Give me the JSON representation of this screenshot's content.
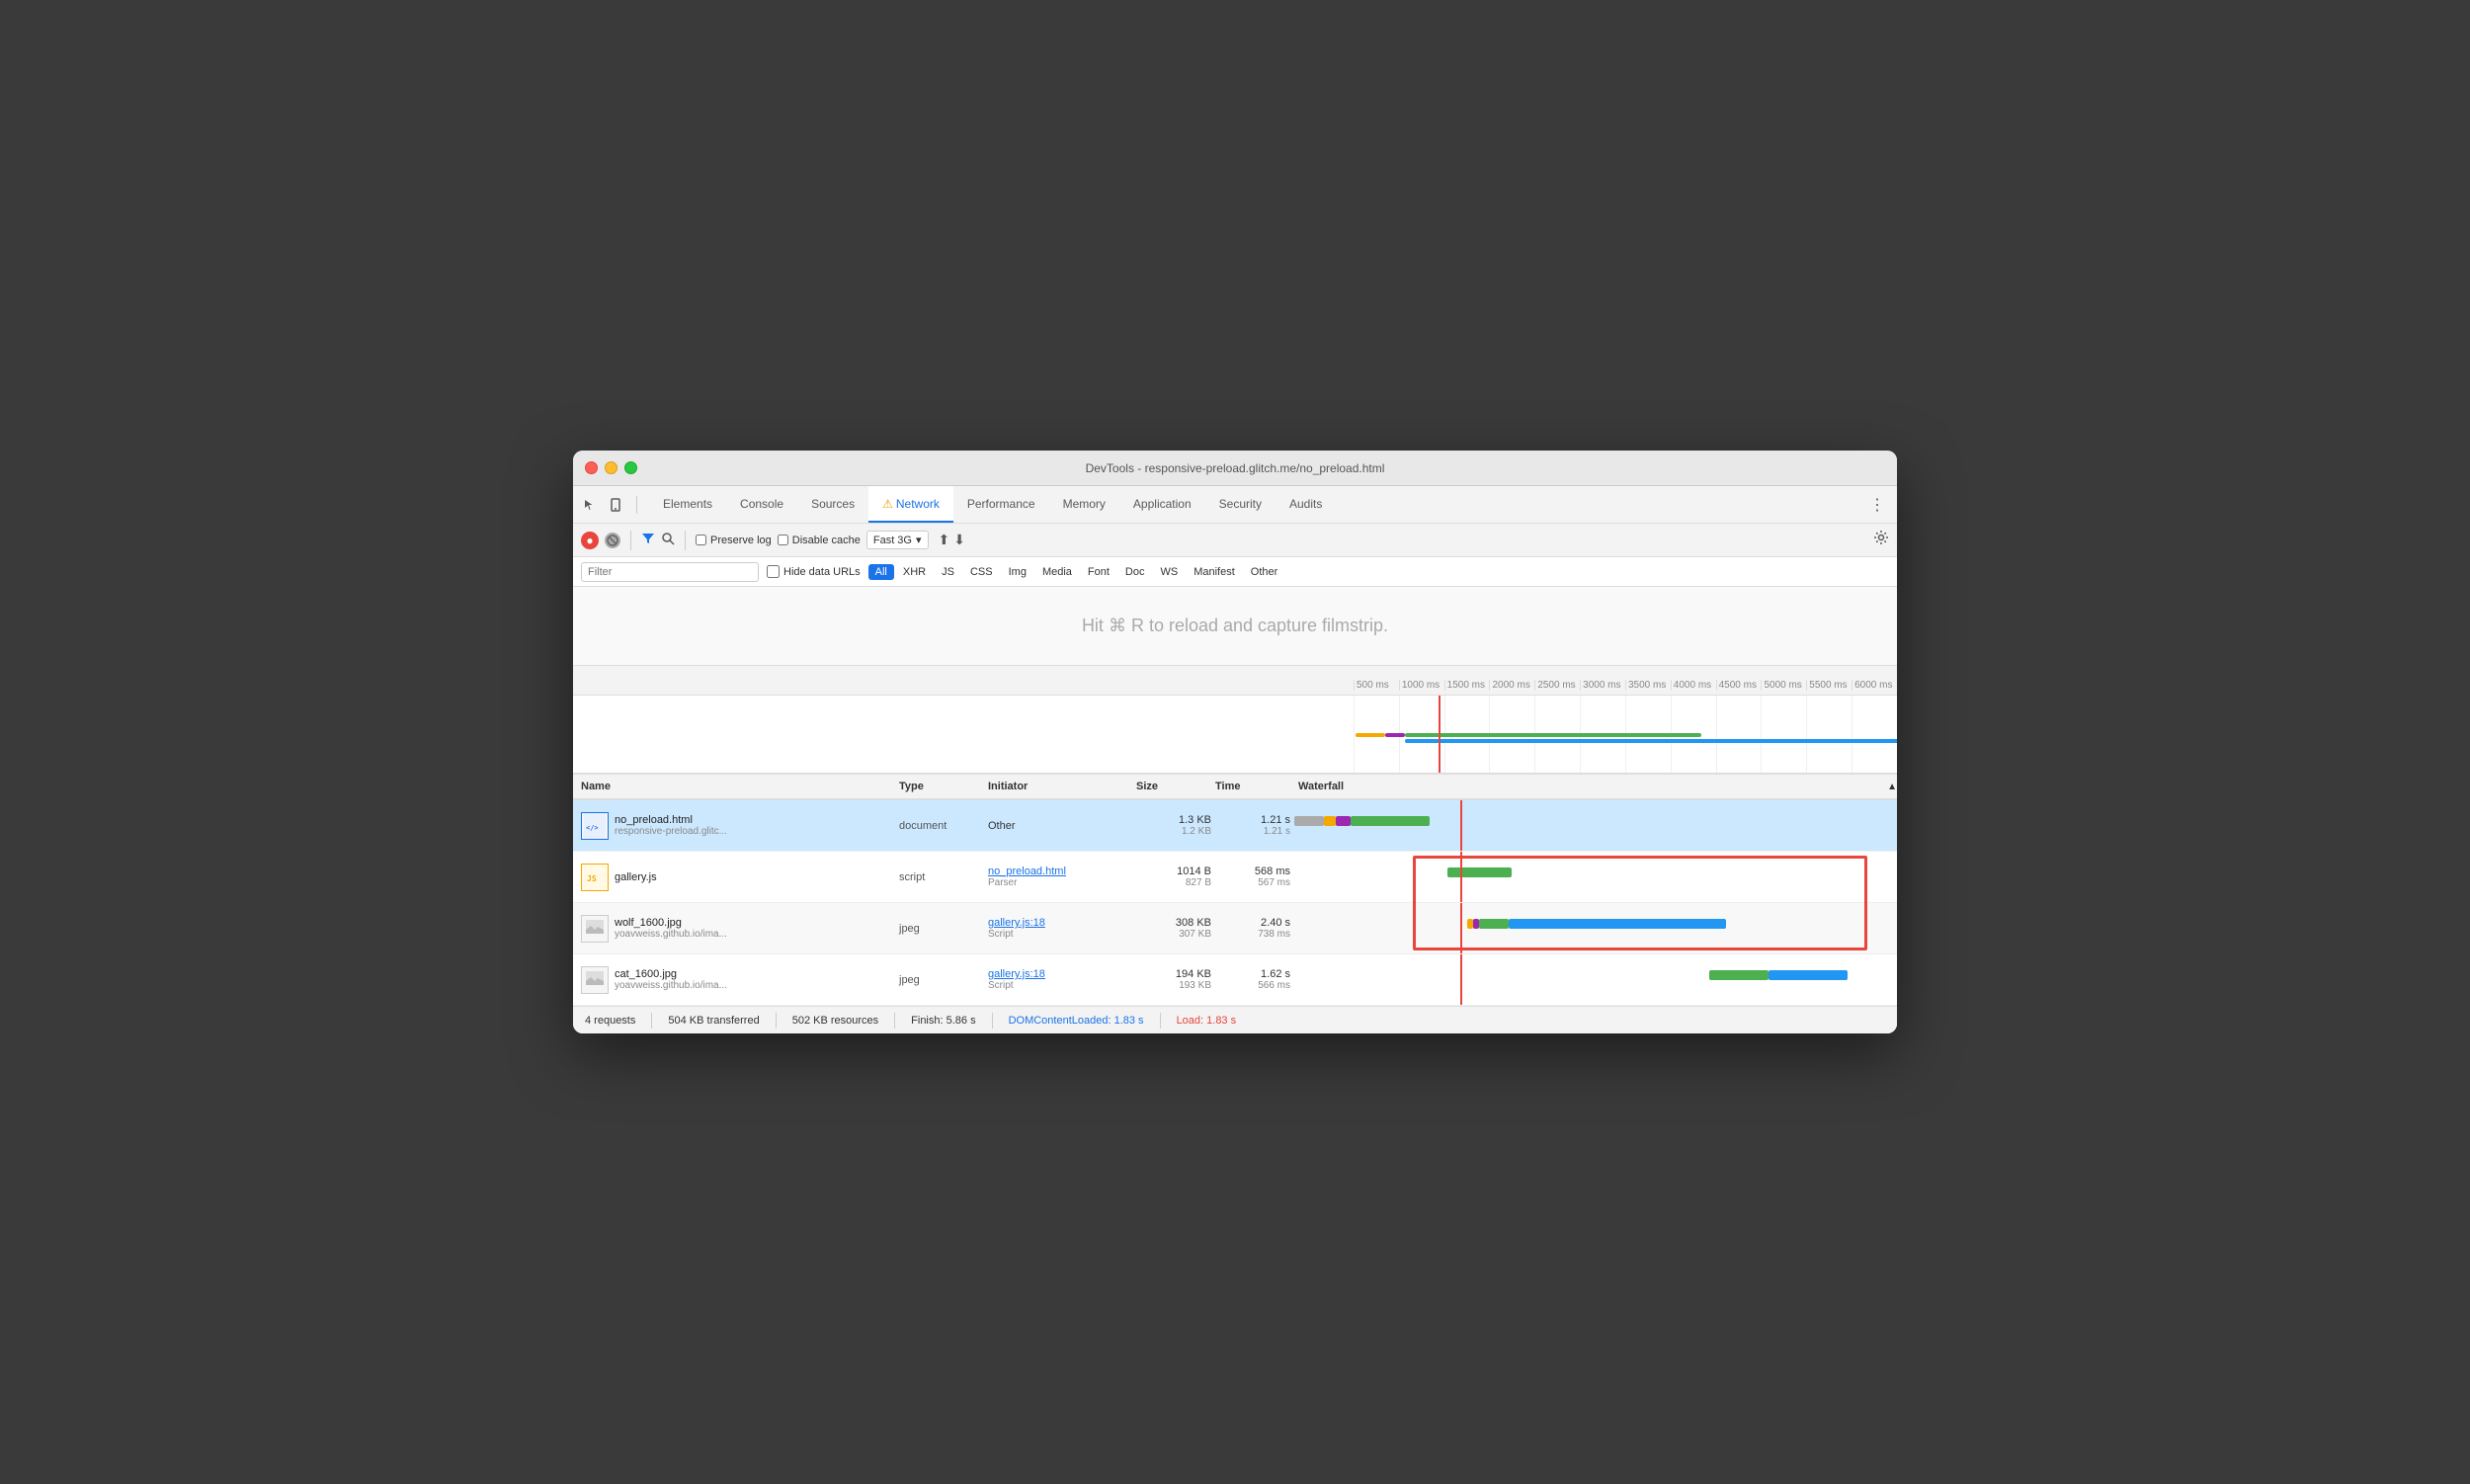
{
  "window": {
    "title": "DevTools - responsive-preload.glitch.me/no_preload.html"
  },
  "tabs": {
    "items": [
      {
        "label": "Elements",
        "active": false
      },
      {
        "label": "Console",
        "active": false
      },
      {
        "label": "Sources",
        "active": false
      },
      {
        "label": "Network",
        "active": true,
        "warning": true
      },
      {
        "label": "Performance",
        "active": false
      },
      {
        "label": "Memory",
        "active": false
      },
      {
        "label": "Application",
        "active": false
      },
      {
        "label": "Security",
        "active": false
      },
      {
        "label": "Audits",
        "active": false
      }
    ]
  },
  "toolbar": {
    "preserve_log": "Preserve log",
    "disable_cache": "Disable cache",
    "throttle": "Fast 3G"
  },
  "filter": {
    "placeholder": "Filter",
    "hide_data_urls": "Hide data URLs",
    "types": [
      "All",
      "XHR",
      "JS",
      "CSS",
      "Img",
      "Media",
      "Font",
      "Doc",
      "WS",
      "Manifest",
      "Other"
    ]
  },
  "filmstrip": {
    "hint": "Hit ⌘ R to reload and capture filmstrip."
  },
  "timeline": {
    "ticks": [
      "500 ms",
      "1000 ms",
      "1500 ms",
      "2000 ms",
      "2500 ms",
      "3000 ms",
      "3500 ms",
      "4000 ms",
      "4500 ms",
      "5000 ms",
      "5500 ms",
      "6000 ms"
    ]
  },
  "table": {
    "headers": {
      "name": "Name",
      "type": "Type",
      "initiator": "Initiator",
      "size": "Size",
      "time": "Time",
      "waterfall": "Waterfall"
    },
    "rows": [
      {
        "icon": "HTML",
        "name": "no_preload.html",
        "url": "responsive-preload.glitc...",
        "type": "document",
        "initiator": "Other",
        "initiator_link": null,
        "initiator_sub": null,
        "size1": "1.3 KB",
        "size2": "1.2 KB",
        "time1": "1.21 s",
        "time2": "1.21 s",
        "selected": true
      },
      {
        "icon": "JS",
        "name": "gallery.js",
        "url": "",
        "type": "script",
        "initiator": "no_preload.html",
        "initiator_link": true,
        "initiator_sub": "Parser",
        "size1": "1014 B",
        "size2": "827 B",
        "time1": "568 ms",
        "time2": "567 ms",
        "selected": false
      },
      {
        "icon": "IMG",
        "name": "wolf_1600.jpg",
        "url": "yoavweiss.github.io/ima...",
        "type": "jpeg",
        "initiator": "gallery.js:18",
        "initiator_link": true,
        "initiator_sub": "Script",
        "size1": "308 KB",
        "size2": "307 KB",
        "time1": "2.40 s",
        "time2": "738 ms",
        "selected": false
      },
      {
        "icon": "IMG",
        "name": "cat_1600.jpg",
        "url": "yoavweiss.github.io/ima...",
        "type": "jpeg",
        "initiator": "gallery.js:18",
        "initiator_link": true,
        "initiator_sub": "Script",
        "size1": "194 KB",
        "size2": "193 KB",
        "time1": "1.62 s",
        "time2": "566 ms",
        "selected": false
      }
    ]
  },
  "statusbar": {
    "requests": "4 requests",
    "transferred": "504 KB transferred",
    "resources": "502 KB resources",
    "finish": "Finish: 5.86 s",
    "dcl": "DOMContentLoaded: 1.83 s",
    "load": "Load: 1.83 s"
  }
}
